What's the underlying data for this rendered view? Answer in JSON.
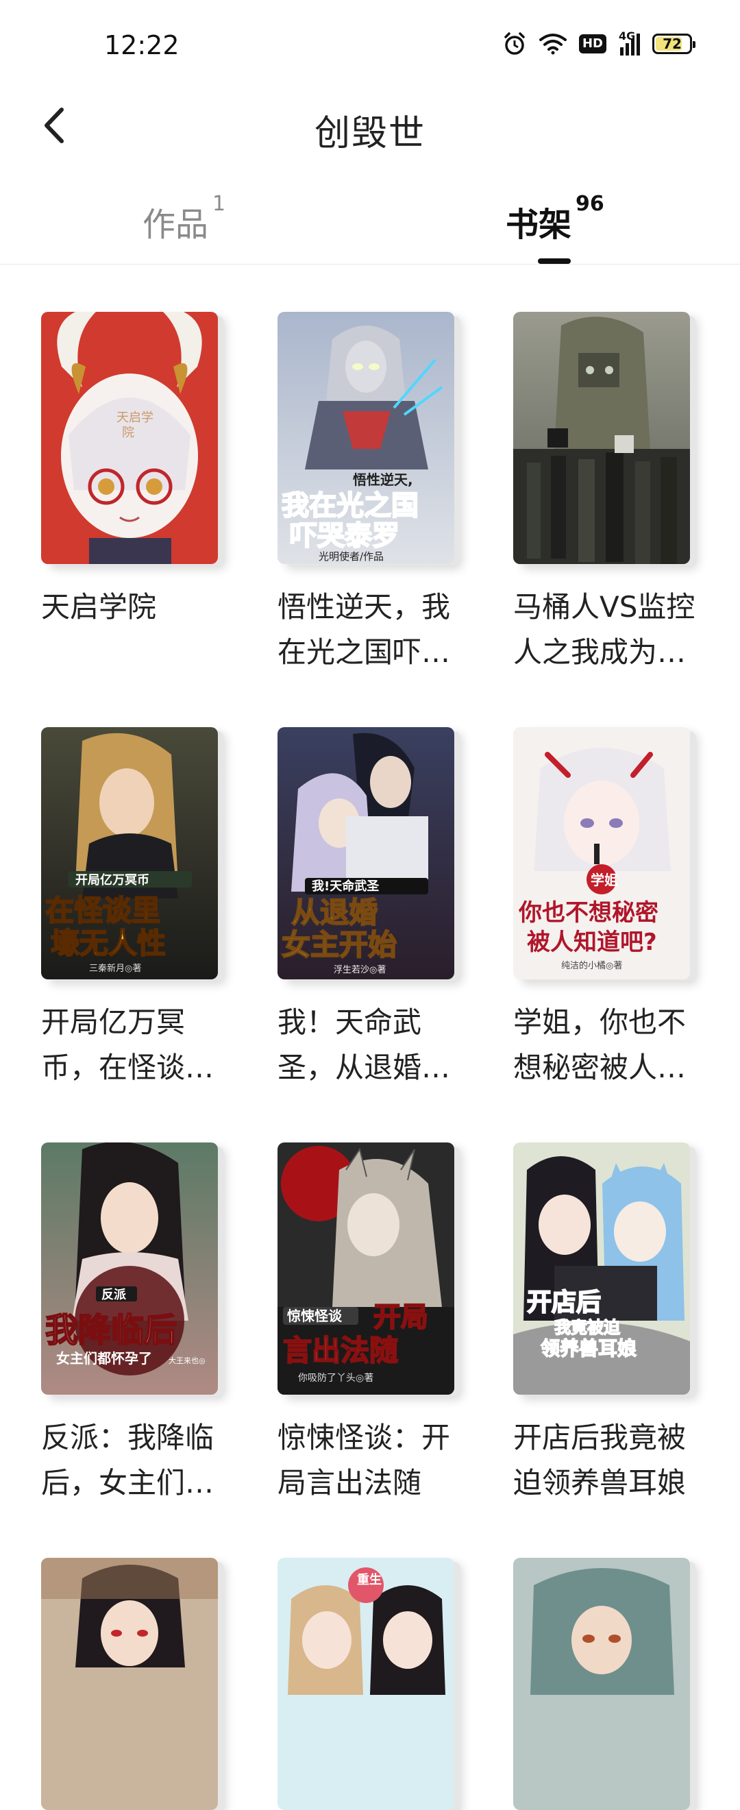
{
  "status_bar": {
    "time": "12:22",
    "battery": "72",
    "network": "4G",
    "hd": "HD"
  },
  "header": {
    "title": "创毁世"
  },
  "tabs": [
    {
      "label": "作品",
      "count": "1"
    },
    {
      "label": "书架",
      "count": "96"
    }
  ],
  "books": [
    {
      "title": "天启学院",
      "cover_text": "天启学院"
    },
    {
      "title": "悟性逆天，我在光之国吓哭泰罗",
      "cover_text": "悟性逆天，我在光之国吓哭泰罗",
      "cover_author": "光明使者/作品"
    },
    {
      "title": "马桶人VS监控人之我成为了泰坦监控人",
      "cover_text": ""
    },
    {
      "title": "开局亿万冥币，在怪谈里壕无人性",
      "cover_text": "开局亿万冥币 在怪谈里壕无人性",
      "cover_author": "三秦新月◎著"
    },
    {
      "title": "我！天命武圣，从退婚女主开始",
      "cover_text": "我！天命武圣 从退婚女主开始",
      "cover_author": "浮生若沙◎著"
    },
    {
      "title": "学姐，你也不想秘密被人知道吧？",
      "cover_text": "学姐 你也不想秘密被人知道吧？",
      "cover_author": "纯洁的小橘◎著"
    },
    {
      "title": "反派：我降临后，女主们都怀孕了",
      "cover_text": "反派 我降临后 女主们都怀孕了",
      "cover_author": "大王来也◎"
    },
    {
      "title": "惊悚怪谈：开局言出法随",
      "cover_text": "惊悚怪谈 开局言出法随",
      "cover_author": "你吸防了丫头◎著"
    },
    {
      "title": "开店后我竟被迫领养兽耳娘",
      "cover_text": "开店后 我竟被迫领养兽耳娘"
    },
    {
      "title": "",
      "cover_text": ""
    },
    {
      "title": "",
      "cover_text": "重生"
    },
    {
      "title": "",
      "cover_text": ""
    }
  ]
}
